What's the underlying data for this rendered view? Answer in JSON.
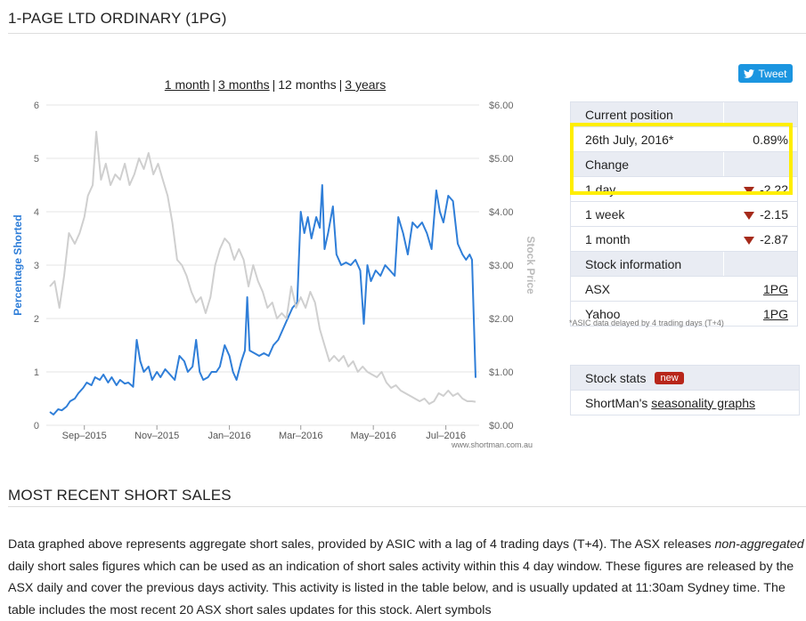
{
  "page": {
    "title": "1-PAGE LTD ORDINARY (1PG)",
    "section2_title": "MOST RECENT SHORT SALES",
    "tweet_label": "Tweet"
  },
  "range_selector": {
    "one_month": "1 month",
    "three_months": "3 months",
    "twelve_months": "12 months",
    "three_years": "3 years",
    "separator": "|"
  },
  "position_table": {
    "current_position_header": "Current position",
    "date": "26th July, 2016*",
    "date_value": "0.89%",
    "change_header": "Change",
    "rows": [
      {
        "label": "1 day",
        "value": "-2.22"
      },
      {
        "label": "1 week",
        "value": "-2.15"
      },
      {
        "label": "1 month",
        "value": "-2.87"
      }
    ],
    "stock_info_header": "Stock information",
    "asx_label": "ASX",
    "asx_link": "1PG",
    "yahoo_label": "Yahoo",
    "yahoo_link": "1PG",
    "footnote": "*ASIC data delayed by 4 trading days (T+4)"
  },
  "stock_stats": {
    "header": "Stock stats",
    "badge": "new",
    "row_prefix": "ShortMan's ",
    "row_link": "seasonality graphs"
  },
  "paragraph": {
    "part1": "Data graphed above represents aggregate short sales, provided by ASIC with a lag of 4 trading days (T+4). The ASX releases ",
    "emph": "non-aggregated",
    "part2": " daily short sales figures which can be used as an indication of short sales activity within this 4 day window. These figures are released by the ASX daily and cover the previous days activity. This activity is listed in the table below, and is usually updated at 11:30am Sydney time. The table includes the most recent 20 ASX short sales updates for this stock. Alert symbols"
  },
  "colors": {
    "short_series": "#2f7ed8",
    "price_series": "#cfcfcf",
    "highlight_box": "#ffee00",
    "down_arrow": "#a52a1a",
    "tweet_button": "#1b95e0"
  },
  "chart_data": {
    "type": "line",
    "title": "",
    "ylabel_left": "Percentage Shorted",
    "ylabel_right": "Stock Price",
    "watermark": "www.shortman.com.au",
    "xlim": [
      "2015-08-03",
      "2016-07-26"
    ],
    "ylim_left": [
      0,
      6
    ],
    "ylim_right": [
      0,
      6
    ],
    "yticks_left": [
      "0",
      "1",
      "2",
      "3",
      "4",
      "5",
      "6"
    ],
    "yticks_right": [
      "$0.00",
      "$1.00",
      "$2.00",
      "$3.00",
      "$4.00",
      "$5.00",
      "$6.00"
    ],
    "xticks": [
      {
        "date": "2015-09-01",
        "label": "Sep–2015"
      },
      {
        "date": "2015-11-01",
        "label": "Nov–2015"
      },
      {
        "date": "2016-01-01",
        "label": "Jan–2016"
      },
      {
        "date": "2016-03-01",
        "label": "Mar–2016"
      },
      {
        "date": "2016-05-01",
        "label": "May–2016"
      },
      {
        "date": "2016-07-01",
        "label": "Jul–2016"
      }
    ],
    "grid": true,
    "series": [
      {
        "name": "Percentage Shorted",
        "axis": "left",
        "points": [
          [
            "2015-08-03",
            0.25
          ],
          [
            "2015-08-06",
            0.2
          ],
          [
            "2015-08-10",
            0.3
          ],
          [
            "2015-08-13",
            0.28
          ],
          [
            "2015-08-17",
            0.35
          ],
          [
            "2015-08-20",
            0.45
          ],
          [
            "2015-08-24",
            0.5
          ],
          [
            "2015-08-27",
            0.6
          ],
          [
            "2015-08-31",
            0.7
          ],
          [
            "2015-09-03",
            0.8
          ],
          [
            "2015-09-07",
            0.75
          ],
          [
            "2015-09-10",
            0.9
          ],
          [
            "2015-09-14",
            0.85
          ],
          [
            "2015-09-17",
            0.95
          ],
          [
            "2015-09-21",
            0.8
          ],
          [
            "2015-09-24",
            0.9
          ],
          [
            "2015-09-28",
            0.75
          ],
          [
            "2015-10-01",
            0.85
          ],
          [
            "2015-10-05",
            0.78
          ],
          [
            "2015-10-08",
            0.8
          ],
          [
            "2015-10-12",
            0.72
          ],
          [
            "2015-10-15",
            1.6
          ],
          [
            "2015-10-18",
            1.2
          ],
          [
            "2015-10-21",
            1.0
          ],
          [
            "2015-10-25",
            1.1
          ],
          [
            "2015-10-28",
            0.85
          ],
          [
            "2015-11-01",
            1.0
          ],
          [
            "2015-11-04",
            0.9
          ],
          [
            "2015-11-08",
            1.05
          ],
          [
            "2015-11-12",
            0.95
          ],
          [
            "2015-11-16",
            0.85
          ],
          [
            "2015-11-20",
            1.3
          ],
          [
            "2015-11-24",
            1.2
          ],
          [
            "2015-11-27",
            1.0
          ],
          [
            "2015-12-01",
            1.1
          ],
          [
            "2015-12-04",
            1.6
          ],
          [
            "2015-12-07",
            1.0
          ],
          [
            "2015-12-10",
            0.85
          ],
          [
            "2015-12-14",
            0.9
          ],
          [
            "2015-12-17",
            1.0
          ],
          [
            "2015-12-21",
            1.0
          ],
          [
            "2015-12-24",
            1.1
          ],
          [
            "2015-12-28",
            1.5
          ],
          [
            "2016-01-01",
            1.3
          ],
          [
            "2016-01-04",
            1.0
          ],
          [
            "2016-01-07",
            0.85
          ],
          [
            "2016-01-11",
            1.2
          ],
          [
            "2016-01-14",
            1.4
          ],
          [
            "2016-01-16",
            2.4
          ],
          [
            "2016-01-18",
            1.4
          ],
          [
            "2016-01-22",
            1.35
          ],
          [
            "2016-01-26",
            1.3
          ],
          [
            "2016-01-30",
            1.35
          ],
          [
            "2016-02-03",
            1.3
          ],
          [
            "2016-02-07",
            1.5
          ],
          [
            "2016-02-11",
            1.6
          ],
          [
            "2016-02-15",
            1.8
          ],
          [
            "2016-02-19",
            2.0
          ],
          [
            "2016-02-23",
            2.2
          ],
          [
            "2016-02-27",
            2.3
          ],
          [
            "2016-03-01",
            4.0
          ],
          [
            "2016-03-04",
            3.6
          ],
          [
            "2016-03-07",
            3.9
          ],
          [
            "2016-03-10",
            3.5
          ],
          [
            "2016-03-14",
            3.9
          ],
          [
            "2016-03-17",
            3.7
          ],
          [
            "2016-03-19",
            4.5
          ],
          [
            "2016-03-21",
            3.3
          ],
          [
            "2016-03-24",
            3.6
          ],
          [
            "2016-03-28",
            4.1
          ],
          [
            "2016-03-31",
            3.2
          ],
          [
            "2016-04-04",
            3.0
          ],
          [
            "2016-04-08",
            3.05
          ],
          [
            "2016-04-12",
            3.0
          ],
          [
            "2016-04-16",
            3.1
          ],
          [
            "2016-04-20",
            2.9
          ],
          [
            "2016-04-23",
            1.9
          ],
          [
            "2016-04-26",
            3.0
          ],
          [
            "2016-04-29",
            2.7
          ],
          [
            "2016-05-03",
            2.9
          ],
          [
            "2016-05-07",
            2.8
          ],
          [
            "2016-05-11",
            3.0
          ],
          [
            "2016-05-15",
            2.9
          ],
          [
            "2016-05-19",
            2.8
          ],
          [
            "2016-05-22",
            3.9
          ],
          [
            "2016-05-26",
            3.6
          ],
          [
            "2016-05-30",
            3.2
          ],
          [
            "2016-06-03",
            3.8
          ],
          [
            "2016-06-07",
            3.7
          ],
          [
            "2016-06-11",
            3.8
          ],
          [
            "2016-06-15",
            3.6
          ],
          [
            "2016-06-19",
            3.3
          ],
          [
            "2016-06-23",
            4.4
          ],
          [
            "2016-06-26",
            4.0
          ],
          [
            "2016-06-29",
            3.8
          ],
          [
            "2016-07-03",
            4.3
          ],
          [
            "2016-07-07",
            4.2
          ],
          [
            "2016-07-11",
            3.4
          ],
          [
            "2016-07-15",
            3.2
          ],
          [
            "2016-07-18",
            3.1
          ],
          [
            "2016-07-21",
            3.2
          ],
          [
            "2016-07-23",
            3.1
          ],
          [
            "2016-07-26",
            0.89
          ]
        ]
      },
      {
        "name": "Stock Price",
        "axis": "right",
        "points": [
          [
            "2015-08-03",
            2.6
          ],
          [
            "2015-08-07",
            2.7
          ],
          [
            "2015-08-11",
            2.2
          ],
          [
            "2015-08-15",
            2.8
          ],
          [
            "2015-08-19",
            3.6
          ],
          [
            "2015-08-24",
            3.4
          ],
          [
            "2015-08-28",
            3.6
          ],
          [
            "2015-09-01",
            3.9
          ],
          [
            "2015-09-04",
            4.3
          ],
          [
            "2015-09-08",
            4.5
          ],
          [
            "2015-09-11",
            5.5
          ],
          [
            "2015-09-15",
            4.6
          ],
          [
            "2015-09-19",
            4.9
          ],
          [
            "2015-09-23",
            4.5
          ],
          [
            "2015-09-27",
            4.7
          ],
          [
            "2015-10-01",
            4.6
          ],
          [
            "2015-10-05",
            4.9
          ],
          [
            "2015-10-09",
            4.5
          ],
          [
            "2015-10-13",
            4.7
          ],
          [
            "2015-10-17",
            5.0
          ],
          [
            "2015-10-21",
            4.8
          ],
          [
            "2015-10-25",
            5.1
          ],
          [
            "2015-10-29",
            4.7
          ],
          [
            "2015-11-02",
            4.9
          ],
          [
            "2015-11-06",
            4.6
          ],
          [
            "2015-11-10",
            4.3
          ],
          [
            "2015-11-14",
            3.8
          ],
          [
            "2015-11-18",
            3.1
          ],
          [
            "2015-11-22",
            3.0
          ],
          [
            "2015-11-26",
            2.8
          ],
          [
            "2015-11-30",
            2.5
          ],
          [
            "2015-12-04",
            2.3
          ],
          [
            "2015-12-08",
            2.4
          ],
          [
            "2015-12-12",
            2.1
          ],
          [
            "2015-12-16",
            2.4
          ],
          [
            "2015-12-20",
            3.0
          ],
          [
            "2015-12-24",
            3.3
          ],
          [
            "2015-12-28",
            3.5
          ],
          [
            "2016-01-01",
            3.4
          ],
          [
            "2016-01-05",
            3.1
          ],
          [
            "2016-01-09",
            3.3
          ],
          [
            "2016-01-13",
            3.1
          ],
          [
            "2016-01-17",
            2.6
          ],
          [
            "2016-01-21",
            3.0
          ],
          [
            "2016-01-25",
            2.7
          ],
          [
            "2016-01-29",
            2.5
          ],
          [
            "2016-02-02",
            2.2
          ],
          [
            "2016-02-06",
            2.3
          ],
          [
            "2016-02-10",
            2.0
          ],
          [
            "2016-02-14",
            2.1
          ],
          [
            "2016-02-18",
            2.0
          ],
          [
            "2016-02-22",
            2.6
          ],
          [
            "2016-02-26",
            2.2
          ],
          [
            "2016-03-01",
            2.4
          ],
          [
            "2016-03-05",
            2.2
          ],
          [
            "2016-03-09",
            2.5
          ],
          [
            "2016-03-13",
            2.3
          ],
          [
            "2016-03-17",
            1.8
          ],
          [
            "2016-03-21",
            1.5
          ],
          [
            "2016-03-25",
            1.2
          ],
          [
            "2016-03-29",
            1.3
          ],
          [
            "2016-04-02",
            1.2
          ],
          [
            "2016-04-06",
            1.3
          ],
          [
            "2016-04-10",
            1.1
          ],
          [
            "2016-04-14",
            1.2
          ],
          [
            "2016-04-18",
            1.0
          ],
          [
            "2016-04-22",
            1.1
          ],
          [
            "2016-04-26",
            1.0
          ],
          [
            "2016-04-30",
            0.95
          ],
          [
            "2016-05-04",
            0.9
          ],
          [
            "2016-05-08",
            1.0
          ],
          [
            "2016-05-12",
            0.8
          ],
          [
            "2016-05-16",
            0.7
          ],
          [
            "2016-05-20",
            0.75
          ],
          [
            "2016-05-24",
            0.65
          ],
          [
            "2016-05-28",
            0.6
          ],
          [
            "2016-06-01",
            0.55
          ],
          [
            "2016-06-05",
            0.5
          ],
          [
            "2016-06-09",
            0.45
          ],
          [
            "2016-06-13",
            0.5
          ],
          [
            "2016-06-17",
            0.4
          ],
          [
            "2016-06-21",
            0.45
          ],
          [
            "2016-06-25",
            0.6
          ],
          [
            "2016-06-29",
            0.55
          ],
          [
            "2016-07-03",
            0.65
          ],
          [
            "2016-07-07",
            0.55
          ],
          [
            "2016-07-11",
            0.6
          ],
          [
            "2016-07-15",
            0.5
          ],
          [
            "2016-07-19",
            0.45
          ],
          [
            "2016-07-23",
            0.45
          ],
          [
            "2016-07-26",
            0.44
          ]
        ]
      }
    ]
  }
}
